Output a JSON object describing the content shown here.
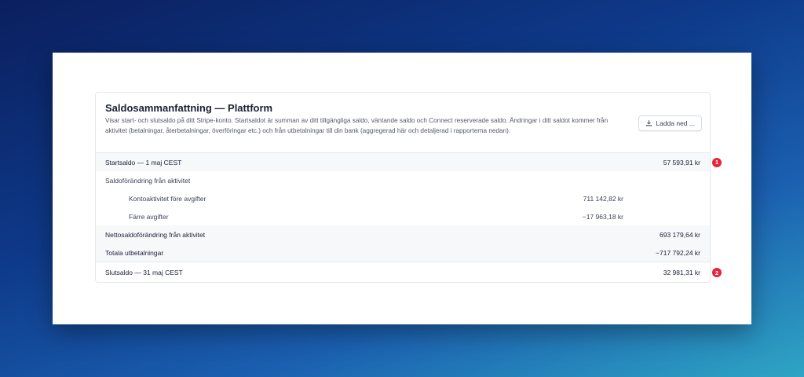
{
  "card": {
    "title": "Saldosammanfattning — Plattform",
    "description": "Visar start- och slutsaldo på ditt Stripe-konto. Startsaldot är summan av ditt tillgängliga saldo, väntande saldo och Connect reserverade saldo. Ändringar i ditt saldot kommer från aktivitet (betalningar, återbetalningar, överföringar etc.) och från utbetalningar till din bank (aggregerad här och detaljerad i rapporterna nedan).",
    "download_label": "Ladda ned ..."
  },
  "rows": {
    "start": {
      "label": "Startsaldo — 1 maj CEST",
      "amount": "57 593,91 kr",
      "marker": "1"
    },
    "change": {
      "label": "Saldoförändring från aktivitet"
    },
    "before_fees": {
      "label": "Kontoaktivitet före avgifter",
      "amount": "711 142,82 kr"
    },
    "fees": {
      "label": "Färre avgifter",
      "amount": "−17 963,18 kr"
    },
    "net_change": {
      "label": "Nettosaldoförändring från aktivitet",
      "amount": "693 179,64 kr"
    },
    "payouts": {
      "label": "Totala utbetalningar",
      "amount": "−717 792,24 kr"
    },
    "end": {
      "label": "Slutsaldo — 31 maj CEST",
      "amount": "32 981,31 kr",
      "marker": "2"
    }
  },
  "colors": {
    "marker": "#e5243b",
    "shaded_row": "#f6f8fa"
  }
}
